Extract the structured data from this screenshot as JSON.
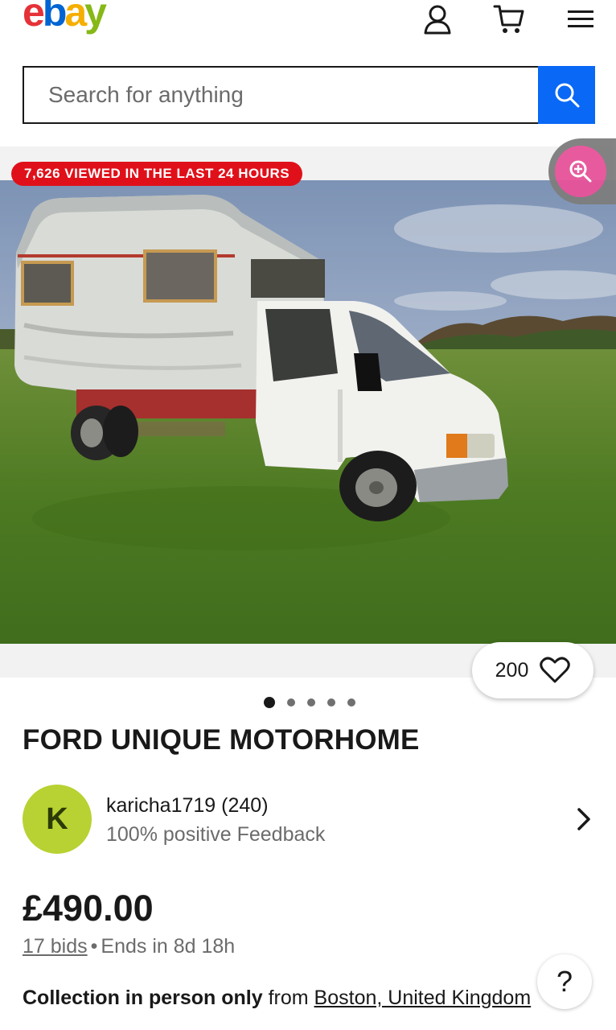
{
  "header": {
    "logo_letters": [
      {
        "ch": "e",
        "color": "#e53238"
      },
      {
        "ch": "b",
        "color": "#0064d2"
      },
      {
        "ch": "a",
        "color": "#f5af02"
      },
      {
        "ch": "y",
        "color": "#86b817"
      }
    ],
    "icons": [
      "account-icon",
      "cart-icon",
      "menu-icon"
    ]
  },
  "search": {
    "placeholder": "Search for anything",
    "button_color": "#0968f6"
  },
  "gallery": {
    "viewed_badge": "7,626 VIEWED IN THE LAST 24 HOURS",
    "watch_count": "200",
    "dots_total": 5,
    "dots_active_index": 0
  },
  "listing": {
    "title": "FORD UNIQUE MOTORHOME",
    "seller": {
      "initial": "K",
      "name": "karicha1719 (240)",
      "feedback": "100% positive Feedback"
    },
    "price": "£490.00",
    "bids": "17 bids",
    "separator": "•",
    "ends": "Ends in 8d 18h",
    "collection_bold": "Collection in person only",
    "collection_from": "from",
    "collection_location": "Boston, United Kingdom"
  },
  "help_label": "?",
  "colors": {
    "badge_red": "#e0101a",
    "zoom_pink": "#e8529a",
    "avatar_green": "#b7d232"
  }
}
